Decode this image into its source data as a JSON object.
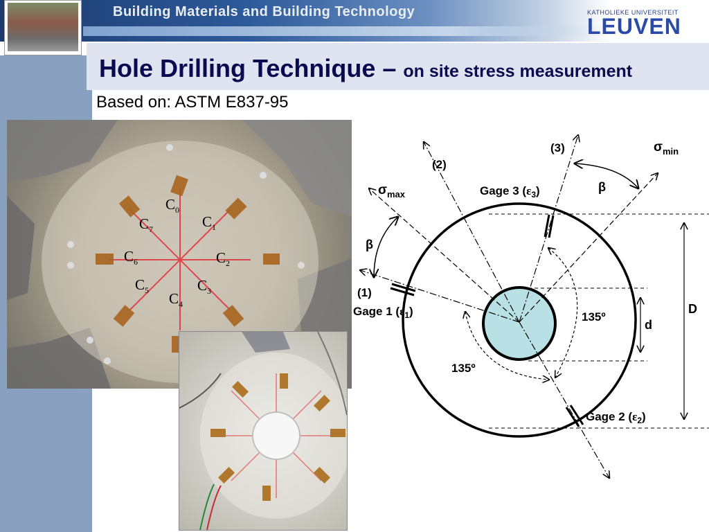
{
  "header": {
    "banner_title": "Building Materials and Building Technology",
    "university_small": "KATHOLIEKE UNIVERSITEIT",
    "university_big": "LEUVEN"
  },
  "slide": {
    "title_main": "Hole Drilling Technique – ",
    "title_sub": "on site stress measurement",
    "subtitle": "Based on: ASTM E837-95"
  },
  "photo": {
    "gauges": [
      {
        "letter": "C",
        "sub": "0"
      },
      {
        "letter": "C",
        "sub": "1"
      },
      {
        "letter": "C",
        "sub": "2"
      },
      {
        "letter": "C",
        "sub": "3"
      },
      {
        "letter": "C",
        "sub": "4"
      },
      {
        "letter": "C",
        "sub": "5"
      },
      {
        "letter": "C",
        "sub": "6"
      },
      {
        "letter": "C",
        "sub": "7"
      }
    ]
  },
  "diagram": {
    "sigma_max": "σ",
    "sigma_max_sub": "max",
    "sigma_min": "σ",
    "sigma_min_sub": "min",
    "dir1": "(1)",
    "dir2": "(2)",
    "dir3": "(3)",
    "beta": "β",
    "gage1_prefix": "Gage 1 (",
    "gage1_eps": "ε",
    "gage1_sub": "1",
    "gage1_suffix": ")",
    "gage2_prefix": "Gage 2 (",
    "gage2_eps": "ε",
    "gage2_sub": "2",
    "gage2_suffix": ")",
    "gage3_prefix": "Gage 3 (",
    "gage3_eps": "ε",
    "gage3_sub": "3",
    "gage3_suffix": ")",
    "angle": "135º",
    "d_label": "d",
    "D_label": "D",
    "colors": {
      "hole_fill": "#b9e0e4",
      "line": "#000000"
    }
  }
}
